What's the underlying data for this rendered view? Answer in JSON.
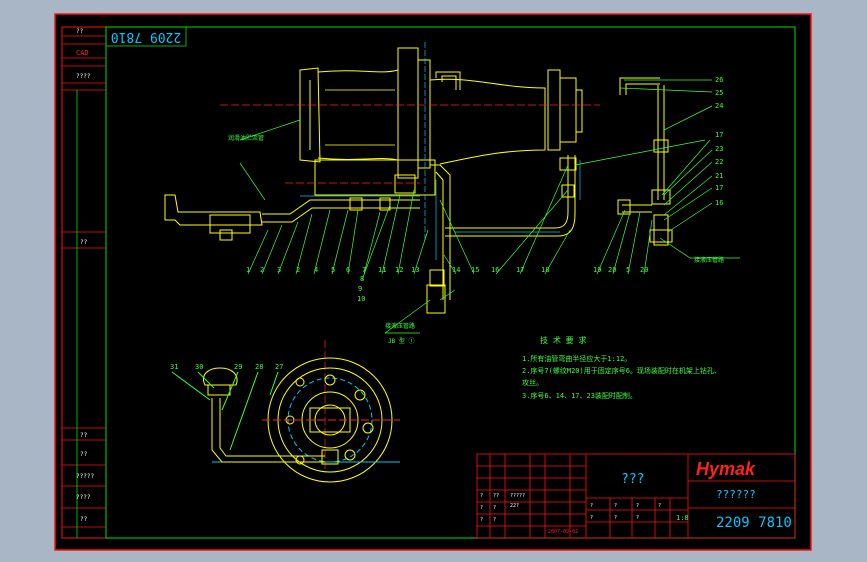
{
  "drawing_number": "2209 7810",
  "drawing_number_rotated": "2209 7810",
  "left_strip": {
    "cad": "CAD",
    "t1": "??",
    "t2": "????",
    "t3": "??",
    "t4": "??",
    "t5": "??",
    "t6": "?????",
    "t7": "????",
    "t8": "??"
  },
  "part_numbers_top": [
    "1",
    "2",
    "3",
    "2",
    "4",
    "5",
    "6",
    "7",
    "11",
    "12",
    "13",
    "14",
    "15",
    "16",
    "17",
    "18"
  ],
  "part_numbers_stack": [
    "8",
    "9",
    "10"
  ],
  "part_numbers_right_bottom": [
    "19",
    "20",
    "5",
    "20"
  ],
  "part_numbers_right_side": [
    "26",
    "25",
    "24",
    "17",
    "23",
    "22",
    "21",
    "17",
    "16"
  ],
  "part_numbers_bottom": [
    "31",
    "30",
    "29",
    "28",
    "27"
  ],
  "callout_left": "润滑油贮流管",
  "callout_bottom": "接液压管路",
  "callout_bottom_sub": "JB 型 ①",
  "callout_right": "接液压管路",
  "tech": {
    "title": "技 术 要 求",
    "line1": "1.所有油管弯曲半径应大于1:12。",
    "line2": "2.序号7(螺纹M20)用于固定序号6。现场装配时在机架上钻孔、",
    "line2b": "攻丝。",
    "line3": "3.序号6、14、17、23装配时配制。"
  },
  "title_block": {
    "part_name": "???",
    "brand": "Hymak",
    "company": "??????",
    "drawing_no": "2209 7810",
    "scale": "1:8",
    "date": "2007-09-02"
  },
  "colors": {
    "background": "#a9b6c5",
    "sheet": "#000000",
    "frame_red": "#ff0000",
    "frame_green": "#00e000",
    "drawing_yellow": "#ffff00",
    "drawing_cyan": "#00c8ff",
    "text_green": "#39ff39",
    "text_white": "#ffffff",
    "text_red": "#ff2020"
  }
}
